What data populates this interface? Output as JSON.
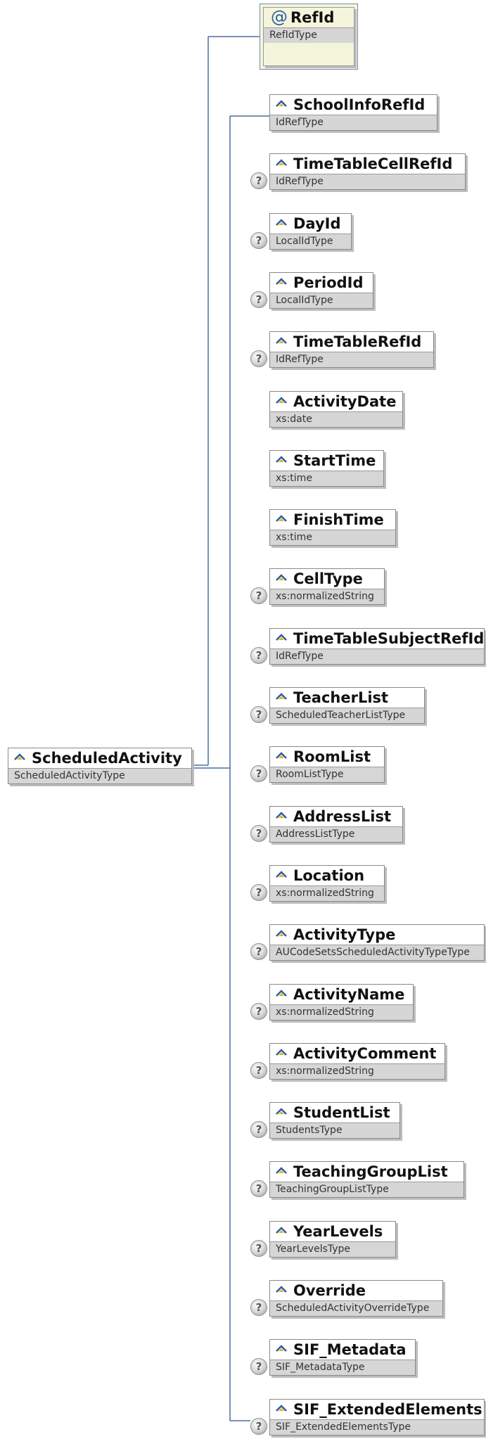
{
  "root": {
    "name": "ScheduledActivity",
    "type": "ScheduledActivityType"
  },
  "attribute": {
    "name": "RefId",
    "type": "RefIdType"
  },
  "elements": [
    {
      "name": "SchoolInfoRefId",
      "type": "IdRefType",
      "optional": false
    },
    {
      "name": "TimeTableCellRefId",
      "type": "IdRefType",
      "optional": true
    },
    {
      "name": "DayId",
      "type": "LocalIdType",
      "optional": true
    },
    {
      "name": "PeriodId",
      "type": "LocalIdType",
      "optional": true
    },
    {
      "name": "TimeTableRefId",
      "type": "IdRefType",
      "optional": true
    },
    {
      "name": "ActivityDate",
      "type": "xs:date",
      "optional": false
    },
    {
      "name": "StartTime",
      "type": "xs:time",
      "optional": false
    },
    {
      "name": "FinishTime",
      "type": "xs:time",
      "optional": false
    },
    {
      "name": "CellType",
      "type": "xs:normalizedString",
      "optional": true
    },
    {
      "name": "TimeTableSubjectRefId",
      "type": "IdRefType",
      "optional": true
    },
    {
      "name": "TeacherList",
      "type": "ScheduledTeacherListType",
      "optional": true
    },
    {
      "name": "RoomList",
      "type": "RoomListType",
      "optional": true
    },
    {
      "name": "AddressList",
      "type": "AddressListType",
      "optional": true
    },
    {
      "name": "Location",
      "type": "xs:normalizedString",
      "optional": true
    },
    {
      "name": "ActivityType",
      "type": "AUCodeSetsScheduledActivityTypeType",
      "optional": true
    },
    {
      "name": "ActivityName",
      "type": "xs:normalizedString",
      "optional": true
    },
    {
      "name": "ActivityComment",
      "type": "xs:normalizedString",
      "optional": true
    },
    {
      "name": "StudentList",
      "type": "StudentsType",
      "optional": true
    },
    {
      "name": "TeachingGroupList",
      "type": "TeachingGroupListType",
      "optional": true
    },
    {
      "name": "YearLevels",
      "type": "YearLevelsType",
      "optional": true
    },
    {
      "name": "Override",
      "type": "ScheduledActivityOverrideType",
      "optional": true
    },
    {
      "name": "SIF_Metadata",
      "type": "SIF_MetadataType",
      "optional": true
    },
    {
      "name": "SIF_ExtendedElements",
      "type": "SIF_ExtendedElementsType",
      "optional": true
    }
  ],
  "optional_marker": "?",
  "attribute_marker": "@",
  "colors": {
    "connector": "#4a6f9e",
    "type_band": "#d6d6d6",
    "attribute_fill": "#f5f5dc"
  }
}
